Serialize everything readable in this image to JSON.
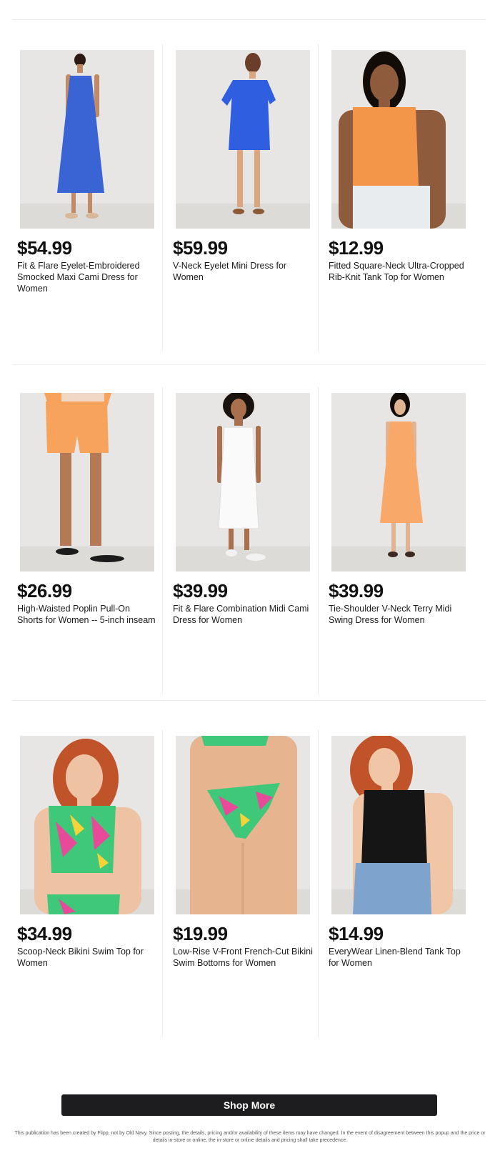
{
  "products": [
    {
      "price": "$54.99",
      "title": "Fit & Flare Eyelet-Embroidered Smocked Maxi Cami Dress for Women",
      "image": "woman-blue-maxi-dress",
      "color": "#3a64d4"
    },
    {
      "price": "$59.99",
      "title": "V-Neck Eyelet Mini Dress for Women",
      "image": "woman-blue-mini-dress",
      "color": "#2f5fe0"
    },
    {
      "price": "$12.99",
      "title": "Fitted Square-Neck Ultra-Cropped Rib-Knit Tank Top for Women",
      "image": "woman-orange-tank-top",
      "color": "#f3964a"
    },
    {
      "price": "$26.99",
      "title": "High-Waisted Poplin Pull-On Shorts for Women -- 5-inch inseam",
      "image": "woman-orange-shorts",
      "color": "#f7a35c"
    },
    {
      "price": "$39.99",
      "title": "Fit & Flare Combination Midi Cami Dress for Women",
      "image": "woman-white-midi-dress",
      "color": "#fafafa"
    },
    {
      "price": "$39.99",
      "title": "Tie-Shoulder V-Neck Terry Midi Swing Dress for Women",
      "image": "woman-orange-swing-dress",
      "color": "#f8a868"
    },
    {
      "price": "$34.99",
      "title": "Scoop-Neck Bikini Swim Top for Women",
      "image": "woman-tropical-bikini-top",
      "color": "#3fc77a"
    },
    {
      "price": "$19.99",
      "title": "Low-Rise V-Front French-Cut Bikini Swim Bottoms for Women",
      "image": "tropical-bikini-bottoms",
      "color": "#3fc77a"
    },
    {
      "price": "$14.99",
      "title": "EveryWear Linen-Blend Tank Top for Women",
      "image": "woman-black-tank-top",
      "color": "#151515"
    }
  ],
  "cta": {
    "label": "Shop More"
  },
  "disclaimer": "This publication has been created by Flipp, not by Old Navy. Since posting, the details, pricing and/or availability of these items may have changed. In the event of disagreement between this popup and the price or details in-store or online, the in-store or online details and pricing shall take precedence."
}
